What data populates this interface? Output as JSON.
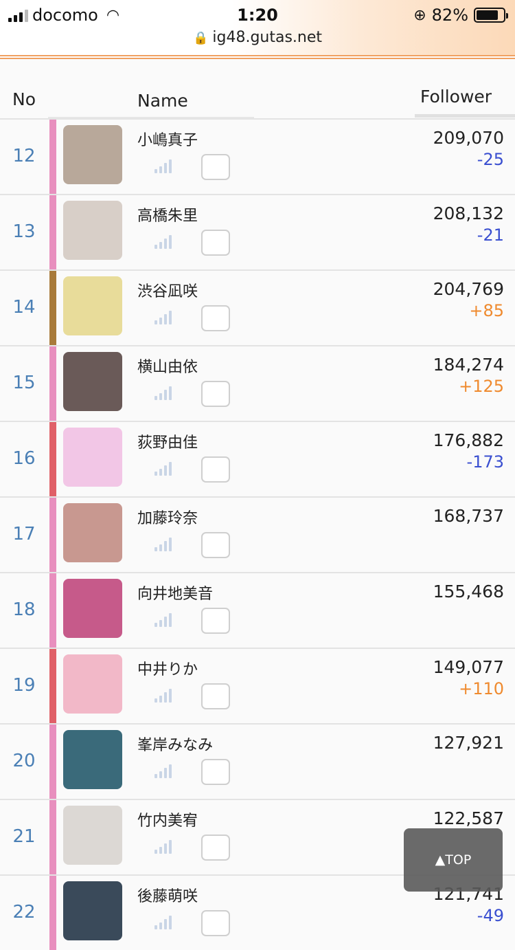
{
  "status": {
    "carrier": "docomo",
    "time": "1:20",
    "battery": "82%",
    "battery_level": 0.82,
    "url": "ig48.gutas.net"
  },
  "header": {
    "no": "No",
    "name": "Name",
    "follower": "Follower"
  },
  "colors": {
    "pink": "#e88fbe",
    "brown": "#a87a3a",
    "red": "#e06068",
    "down": "#3a4fd0",
    "up": "#ef8a2e"
  },
  "rows": [
    {
      "rank": "12",
      "name": "小嶋真子",
      "count": "209,070",
      "diff": "-25",
      "diff_dir": "down",
      "bar": "pink",
      "avatar": "#b8a89a"
    },
    {
      "rank": "13",
      "name": "高橋朱里",
      "count": "208,132",
      "diff": "-21",
      "diff_dir": "down",
      "bar": "pink",
      "avatar": "#d8cfc8"
    },
    {
      "rank": "14",
      "name": "渋谷凪咲",
      "count": "204,769",
      "diff": "+85",
      "diff_dir": "up",
      "bar": "brown",
      "avatar": "#e8dc9a"
    },
    {
      "rank": "15",
      "name": "横山由依",
      "count": "184,274",
      "diff": "+125",
      "diff_dir": "up",
      "bar": "pink",
      "avatar": "#6a5a58"
    },
    {
      "rank": "16",
      "name": "荻野由佳",
      "count": "176,882",
      "diff": "-173",
      "diff_dir": "down",
      "bar": "red",
      "avatar": "#f2c6e6"
    },
    {
      "rank": "17",
      "name": "加藤玲奈",
      "count": "168,737",
      "diff": "",
      "diff_dir": "none",
      "bar": "pink",
      "avatar": "#c89890"
    },
    {
      "rank": "18",
      "name": "向井地美音",
      "count": "155,468",
      "diff": "",
      "diff_dir": "none",
      "bar": "pink",
      "avatar": "#c65a8a"
    },
    {
      "rank": "19",
      "name": "中井りか",
      "count": "149,077",
      "diff": "+110",
      "diff_dir": "up",
      "bar": "red",
      "avatar": "#f2b8c8"
    },
    {
      "rank": "20",
      "name": "峯岸みなみ",
      "count": "127,921",
      "diff": "",
      "diff_dir": "none",
      "bar": "pink",
      "avatar": "#3a6a7a"
    },
    {
      "rank": "21",
      "name": "竹内美宥",
      "count": "122,587",
      "diff": "",
      "diff_dir": "none",
      "bar": "pink",
      "avatar": "#dcd8d4"
    },
    {
      "rank": "22",
      "name": "後藤萌咲",
      "count": "121,741",
      "diff": "-49",
      "diff_dir": "down",
      "bar": "pink",
      "avatar": "#3a4a5a"
    }
  ],
  "top_button": "▲TOP"
}
